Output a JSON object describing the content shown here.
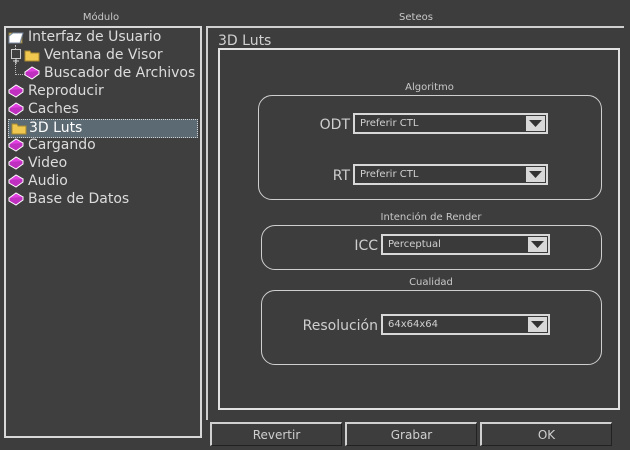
{
  "headers": {
    "module": "Módulo",
    "settings": "Seteos"
  },
  "tree": [
    {
      "label": "Interfaz de Usuario",
      "icon": "folder-open-icon"
    },
    {
      "label": "Ventana de Visor",
      "icon": "folder-icon"
    },
    {
      "label": "Buscador de Archivos",
      "icon": "book-icon"
    },
    {
      "label": "Reproducir",
      "icon": "book-icon"
    },
    {
      "label": "Caches",
      "icon": "book-icon"
    },
    {
      "label": "3D Luts",
      "icon": "folder-icon",
      "selected": true
    },
    {
      "label": "Cargando",
      "icon": "book-icon"
    },
    {
      "label": "Video",
      "icon": "book-icon"
    },
    {
      "label": "Audio",
      "icon": "book-icon"
    },
    {
      "label": "Base de Datos",
      "icon": "book-icon"
    }
  ],
  "panel": {
    "title": "3D Luts"
  },
  "groups": {
    "algorithm": {
      "title": "Algoritmo",
      "odt": {
        "label": "ODT",
        "value": "Preferir CTL"
      },
      "rt": {
        "label": "RT",
        "value": "Preferir CTL"
      }
    },
    "render_intent": {
      "title": "Intención de Render",
      "icc": {
        "label": "ICC",
        "value": "Perceptual"
      }
    },
    "quality": {
      "title": "Cualidad",
      "resolution": {
        "label": "Resolución",
        "value": "64x64x64"
      }
    }
  },
  "buttons": {
    "revert": "Revertir",
    "save": "Grabar",
    "ok": "OK"
  },
  "colors": {
    "background": "#3d3d3d",
    "selection": "#5c6a74",
    "border": "#d8d8d8"
  }
}
